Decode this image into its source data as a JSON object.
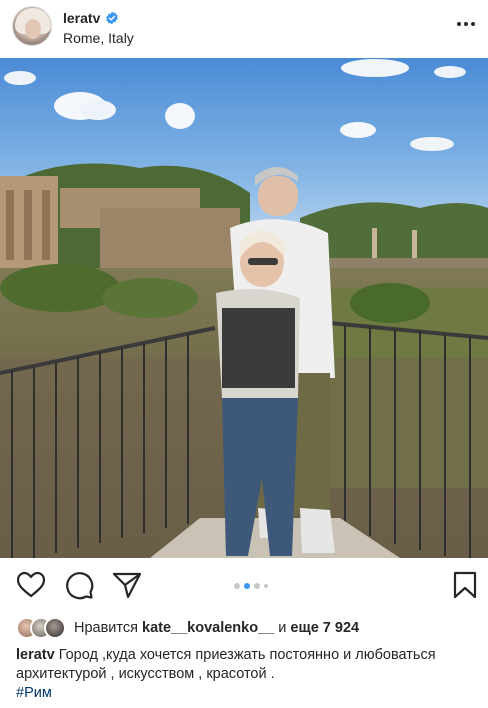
{
  "post": {
    "username": "leratv",
    "location": "Rome, Italy",
    "verified": true
  },
  "actions": {
    "like_icon": "heart-icon",
    "comment_icon": "comment-icon",
    "share_icon": "share-icon",
    "save_icon": "bookmark-icon",
    "carousel_count": 4,
    "carousel_active_index": 1
  },
  "likes": {
    "prefix": "Нравится",
    "liker": "kate__kovalenko__",
    "connector": "и",
    "others": "еще 7 924"
  },
  "caption": {
    "username": "leratv",
    "text": "Город ,куда хочется приезжать постоянно и любоваться архитектурой , искусством , красотой .",
    "hashtag": "#Рим"
  },
  "colors": {
    "text": "#262626",
    "verified": "#3897f0",
    "hashtag": "#003569",
    "active_dot": "#3897f0"
  }
}
